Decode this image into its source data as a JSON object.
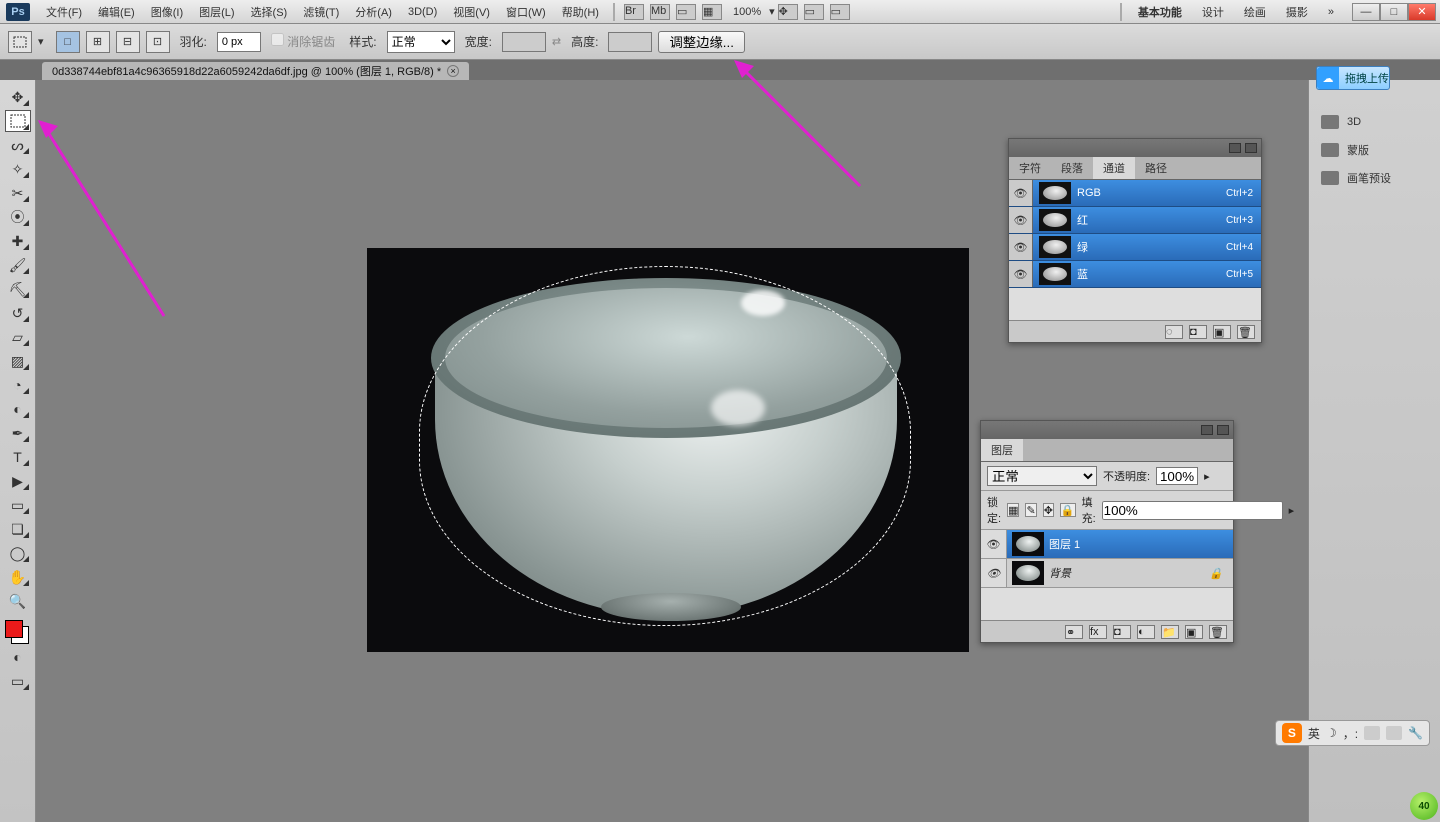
{
  "menu": {
    "items": [
      "文件(F)",
      "编辑(E)",
      "图像(I)",
      "图层(L)",
      "选择(S)",
      "滤镜(T)",
      "分析(A)",
      "3D(D)",
      "视图(V)",
      "窗口(W)",
      "帮助(H)"
    ],
    "zoom": "100%",
    "workspaces": [
      "基本功能",
      "设计",
      "绘画",
      "摄影"
    ]
  },
  "options": {
    "feather_label": "羽化:",
    "feather": "0 px",
    "antialias": "消除锯齿",
    "style_label": "样式:",
    "style": "正常",
    "width_label": "宽度:",
    "width": "",
    "height_label": "高度:",
    "height": "",
    "refine": "调整边缘..."
  },
  "doc_tab": "0d338744ebf81a4c96365918d22a6059242da6df.jpg @ 100% (图层 1, RGB/8) *",
  "channels_panel": {
    "tabs": [
      "字符",
      "段落",
      "通道",
      "路径"
    ],
    "rows": [
      {
        "name": "RGB",
        "shortcut": "Ctrl+2"
      },
      {
        "name": "红",
        "shortcut": "Ctrl+3"
      },
      {
        "name": "绿",
        "shortcut": "Ctrl+4"
      },
      {
        "name": "蓝",
        "shortcut": "Ctrl+5"
      }
    ]
  },
  "layers_panel": {
    "tab": "图层",
    "blend": "正常",
    "opacity_label": "不透明度:",
    "opacity": "100%",
    "lock_label": "锁定:",
    "fill_label": "填充:",
    "fill": "100%",
    "layers": [
      {
        "name": "图层 1",
        "selected": true,
        "locked": false
      },
      {
        "name": "背景",
        "selected": false,
        "locked": true
      }
    ],
    "fx_label": "fx"
  },
  "right_strip": {
    "upload": "拖拽上传",
    "items": [
      "3D",
      "蒙版",
      "画笔预设"
    ]
  },
  "ime": {
    "lang": "英",
    "badge": "40"
  }
}
